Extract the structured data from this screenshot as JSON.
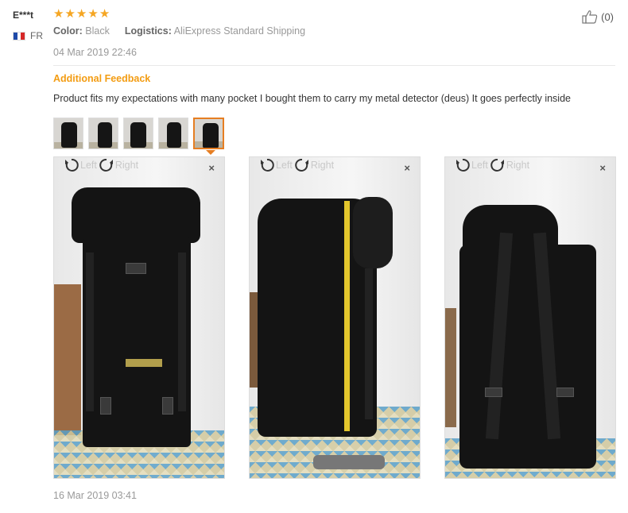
{
  "reviewer": {
    "name": "E***t",
    "country_code": "FR",
    "flag_colors": [
      "#1f4aa8",
      "#ffffff",
      "#d62828"
    ]
  },
  "rating": {
    "stars": 5,
    "star_color": "#f5a623"
  },
  "order": {
    "color_label": "Color:",
    "color_value": "Black",
    "logistics_label": "Logistics:",
    "logistics_value": "AliExpress Standard Shipping"
  },
  "review_date": "04 Mar 2019 22:46",
  "helpful": {
    "icon": "thumbs-up-icon",
    "count": "(0)"
  },
  "additional": {
    "title": "Additional Feedback",
    "title_color": "#f39c12",
    "text": "Product fits my expectations with many pocket I bought them to carry my metal detector (deus) It goes perfectly inside",
    "thumbnails_count": 5,
    "active_thumbnail": 5
  },
  "photo_viewer": {
    "rotate_left_label": "Left",
    "rotate_right_label": "Right",
    "close_label": "×",
    "photos": [
      {
        "subject": "backpack-front"
      },
      {
        "subject": "backpack-side-with-tape-measure"
      },
      {
        "subject": "backpack-back"
      }
    ]
  },
  "additional_date": "16 Mar 2019 03:41"
}
